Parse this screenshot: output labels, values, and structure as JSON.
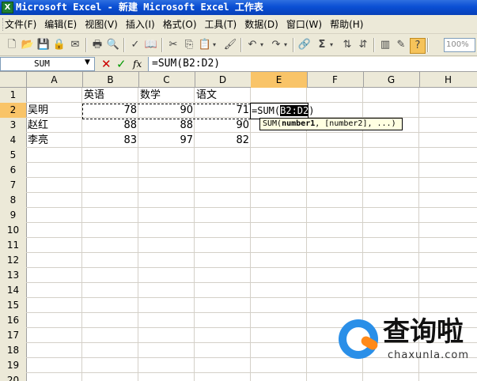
{
  "window": {
    "title": "Microsoft Excel - 新建 Microsoft Excel 工作表",
    "icon": "excel-icon"
  },
  "menu": [
    "文件(F)",
    "编辑(E)",
    "视图(V)",
    "插入(I)",
    "格式(O)",
    "工具(T)",
    "数据(D)",
    "窗口(W)",
    "帮助(H)"
  ],
  "toolbar": {
    "zoom": "100%"
  },
  "formula_bar": {
    "name_box": "SUM",
    "cancel": "✕",
    "enter": "✓",
    "fx": "fx",
    "formula": "=SUM(B2:D2)"
  },
  "columns": [
    "A",
    "B",
    "C",
    "D",
    "E",
    "F",
    "G",
    "H"
  ],
  "rows": [
    "1",
    "2",
    "3",
    "4",
    "5",
    "6",
    "7",
    "8",
    "9",
    "10",
    "11",
    "12",
    "13",
    "14",
    "15",
    "16",
    "17",
    "18",
    "19",
    "20"
  ],
  "active": {
    "column": "E",
    "row": "2"
  },
  "cells": {
    "B1": "英语",
    "C1": "数学",
    "D1": "语文",
    "A2": "吴明",
    "B2": "78",
    "C2": "90",
    "D2": "71",
    "A3": "赵红",
    "B3": "88",
    "C3": "88",
    "D3": "90",
    "A4": "李亮",
    "B4": "83",
    "C4": "97",
    "D4": "82"
  },
  "editing": {
    "prefix": "=SUM(",
    "ref": "B2:D2",
    "suffix": ")"
  },
  "tooltip": {
    "fn": "SUM(",
    "arg1": "number1",
    "rest": ", [number2], ...)"
  },
  "watermark": {
    "brand": "查询啦",
    "url": "chaxunla.com"
  }
}
